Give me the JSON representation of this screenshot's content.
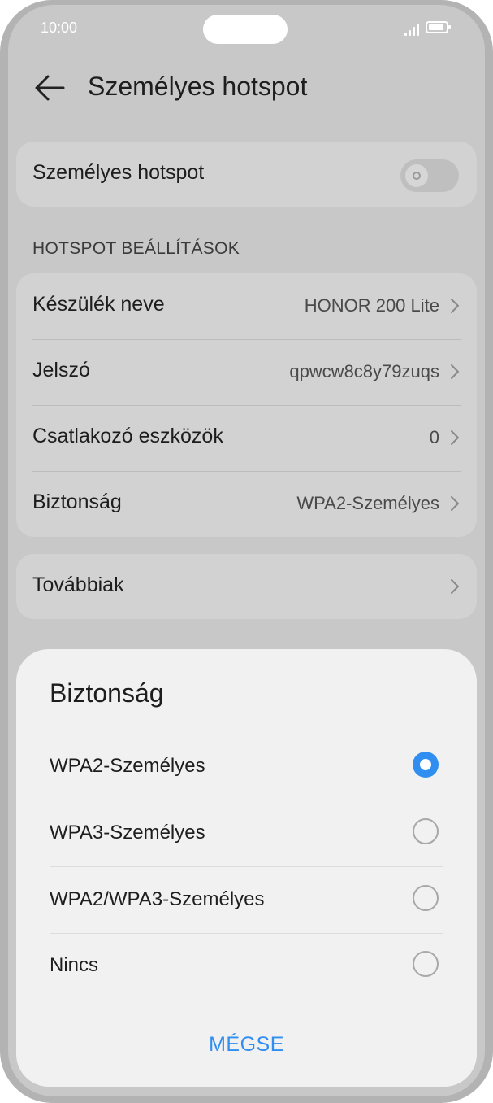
{
  "status": {
    "time": "10:00"
  },
  "header": {
    "title": "Személyes hotspot"
  },
  "hotspot_toggle": {
    "label": "Személyes hotspot",
    "enabled": false
  },
  "settings": {
    "section_title": "HOTSPOT BEÁLLÍTÁSOK",
    "rows": [
      {
        "label": "Készülék neve",
        "value": "HONOR 200 Lite"
      },
      {
        "label": "Jelszó",
        "value": "qpwcw8c8y79zuqs"
      },
      {
        "label": "Csatlakozó eszközök",
        "value": "0"
      },
      {
        "label": "Biztonság",
        "value": "WPA2-Személyes"
      }
    ]
  },
  "more": {
    "label": "Továbbiak"
  },
  "dialog": {
    "title": "Biztonság",
    "options": [
      {
        "label": "WPA2-Személyes",
        "selected": true
      },
      {
        "label": "WPA3-Személyes",
        "selected": false
      },
      {
        "label": "WPA2/WPA3-Személyes",
        "selected": false
      },
      {
        "label": "Nincs",
        "selected": false
      }
    ],
    "cancel_label": "MÉGSE"
  },
  "colors": {
    "accent": "#2f8ef0",
    "dim_background": "#c8c8c8",
    "dialog_background": "#f1f1f1"
  },
  "icons": {
    "back": "arrow-left-icon",
    "chevron": "chevron-right-icon"
  }
}
